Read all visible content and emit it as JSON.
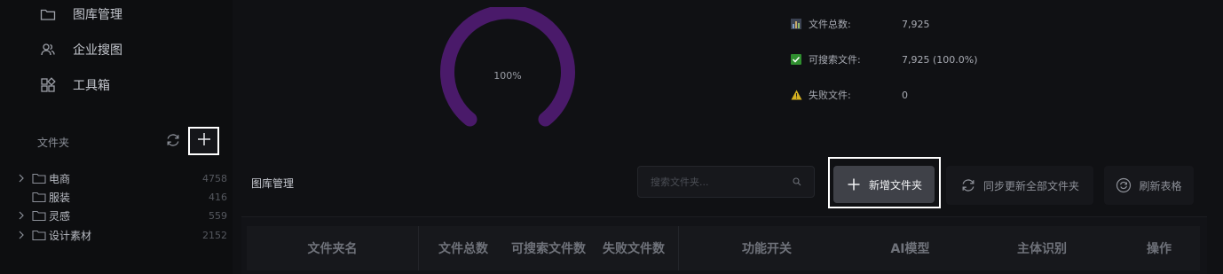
{
  "sidebar": {
    "nav": [
      {
        "label": "图库管理",
        "icon": "folder-icon"
      },
      {
        "label": "企业搜图",
        "icon": "users-icon"
      },
      {
        "label": "工具箱",
        "icon": "toolbox-icon"
      }
    ],
    "folders_title": "文件夹",
    "tree": [
      {
        "label": "电商",
        "count": "4758",
        "expandable": true
      },
      {
        "label": "服装",
        "count": "416",
        "expandable": false
      },
      {
        "label": "灵感",
        "count": "559",
        "expandable": true
      },
      {
        "label": "设计素材",
        "count": "2152",
        "expandable": true
      }
    ]
  },
  "gauge": {
    "label": "100%",
    "percent": 100,
    "color": "#4a1a6a"
  },
  "stats": [
    {
      "icon": "bar-chart-icon",
      "label": "文件总数:",
      "value": "7,925"
    },
    {
      "icon": "check-icon",
      "label": "可搜索文件:",
      "value": "7,925  (100.0%)"
    },
    {
      "icon": "warning-icon",
      "label": "失败文件:",
      "value": "0"
    }
  ],
  "main": {
    "title": "图库管理",
    "search_placeholder": "搜索文件夹...",
    "add_folder_label": "新增文件夹",
    "sync_all_label": "同步更新全部文件夹",
    "refresh_table_label": "刷新表格"
  },
  "table": {
    "columns": [
      "文件夹名",
      "文件总数",
      "可搜索文件数",
      "失败文件数",
      "功能开关",
      "AI模型",
      "主体识别",
      "操作"
    ]
  }
}
